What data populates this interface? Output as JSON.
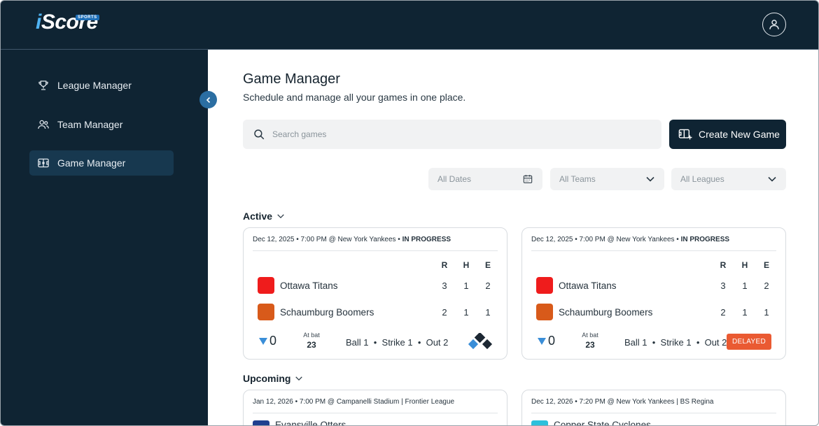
{
  "app": {
    "logo_main": "Score",
    "logo_i": "i",
    "logo_badge": "SPORTS"
  },
  "sidebar": {
    "items": [
      {
        "label": "League Manager",
        "icon": "trophy-icon",
        "active": false
      },
      {
        "label": "Team Manager",
        "icon": "users-icon",
        "active": false
      },
      {
        "label": "Game Manager",
        "icon": "scoreboard-icon",
        "active": true
      }
    ]
  },
  "main": {
    "title": "Game Manager",
    "subtitle": "Schedule and manage all your games in one place.",
    "search_placeholder": "Search games",
    "create_label": "Create New Game",
    "filters": {
      "dates": "All Dates",
      "teams": "All Teams",
      "leagues": "All Leagues"
    }
  },
  "sections": {
    "active": "Active",
    "upcoming": "Upcoming"
  },
  "active_games": [
    {
      "date": "Dec 12, 2025 • 7:00 PM @ New York Yankees • ",
      "status": "IN PROGRESS",
      "cols": [
        "R",
        "H",
        "E"
      ],
      "teams": [
        {
          "name": "Ottawa Titans",
          "color": "#ef1c1c",
          "r": "3",
          "h": "1",
          "e": "2"
        },
        {
          "name": "Schaumburg Boomers",
          "color": "#d85a1a",
          "r": "2",
          "h": "1",
          "e": "1"
        }
      ],
      "outs": "0",
      "at_bat_label": "At bat",
      "at_bat_number": "23",
      "count": "Ball 1  •  Strike 1  •  Out 2",
      "badge": ""
    },
    {
      "date": "Dec 12, 2025 • 7:00 PM @ New York Yankees • ",
      "status": "IN PROGRESS",
      "cols": [
        "R",
        "H",
        "E"
      ],
      "teams": [
        {
          "name": "Ottawa Titans",
          "color": "#ef1c1c",
          "r": "3",
          "h": "1",
          "e": "2"
        },
        {
          "name": "Schaumburg Boomers",
          "color": "#d85a1a",
          "r": "2",
          "h": "1",
          "e": "1"
        }
      ],
      "outs": "0",
      "at_bat_label": "At bat",
      "at_bat_number": "23",
      "count": "Ball 1  •  Strike 1  •  Out 2",
      "badge": "DELAYED"
    }
  ],
  "upcoming_games": [
    {
      "date": "Jan 12, 2026 • 7:00 PM @ Campanelli Stadium | Frontier League",
      "team": "Evansville Otters",
      "color": "#1f3f8f"
    },
    {
      "date": "Dec 12, 2026 • 7:20 PM @ New York Yankees | BS Regina",
      "team": "Copper State Cyclones",
      "color": "#2cc0dc"
    }
  ]
}
